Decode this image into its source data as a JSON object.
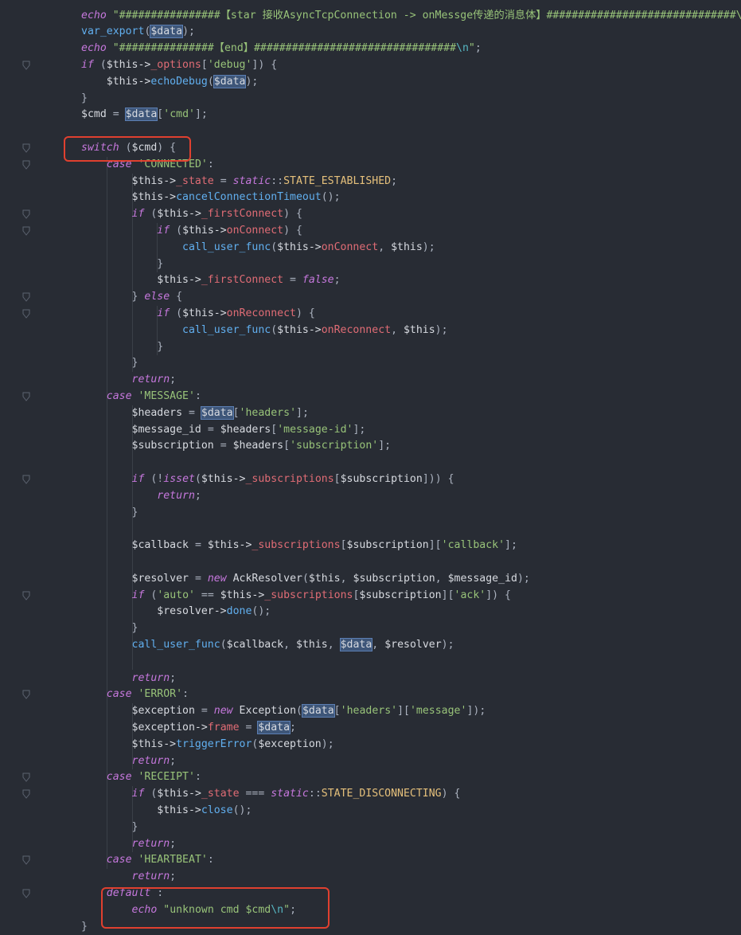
{
  "code_lines": [
    [
      [
        "kw",
        "echo"
      ],
      [
        "punc",
        " "
      ],
      [
        "str",
        "\"################【star 接收AsyncTcpConnection -> onMessge传递的消息体】##############################\\n"
      ]
    ],
    [
      [
        "fn",
        "var_export"
      ],
      [
        "punc",
        "("
      ],
      [
        "hl",
        "$data"
      ],
      [
        "punc",
        ");"
      ]
    ],
    [
      [
        "kw",
        "echo"
      ],
      [
        "punc",
        " "
      ],
      [
        "str",
        "\"###############【end】################################"
      ],
      [
        "esc",
        "\\n"
      ],
      [
        "str",
        "\""
      ],
      [
        "punc",
        ";"
      ]
    ],
    [
      [
        "kw",
        "if"
      ],
      [
        "punc",
        " ("
      ],
      [
        "var",
        "$this->"
      ],
      [
        "prop",
        "_options"
      ],
      [
        "punc",
        "["
      ],
      [
        "str",
        "'debug'"
      ],
      [
        "punc",
        "]) {"
      ]
    ],
    [
      [
        "punc",
        "    "
      ],
      [
        "var",
        "$this->"
      ],
      [
        "fn",
        "echoDebug"
      ],
      [
        "punc",
        "("
      ],
      [
        "hl",
        "$data"
      ],
      [
        "punc",
        ");"
      ]
    ],
    [
      [
        "punc",
        "}"
      ]
    ],
    [
      [
        "var",
        "$cmd"
      ],
      [
        "punc",
        " = "
      ],
      [
        "hl",
        "$data"
      ],
      [
        "punc",
        "["
      ],
      [
        "str",
        "'cmd'"
      ],
      [
        "punc",
        "];"
      ]
    ],
    [],
    [
      [
        "kw",
        "switch"
      ],
      [
        "punc",
        " ("
      ],
      [
        "var",
        "$cmd"
      ],
      [
        "punc",
        ") {"
      ]
    ],
    [
      [
        "punc",
        "    "
      ],
      [
        "kw",
        "case"
      ],
      [
        "punc",
        " "
      ],
      [
        "str",
        "'CONNECTED'"
      ],
      [
        "punc",
        ":"
      ]
    ],
    [
      [
        "punc",
        "        "
      ],
      [
        "var",
        "$this->"
      ],
      [
        "prop",
        "_state"
      ],
      [
        "punc",
        " = "
      ],
      [
        "kw",
        "static"
      ],
      [
        "punc",
        "::"
      ],
      [
        "const",
        "STATE_ESTABLISHED"
      ],
      [
        "punc",
        ";"
      ]
    ],
    [
      [
        "punc",
        "        "
      ],
      [
        "var",
        "$this->"
      ],
      [
        "fn",
        "cancelConnectionTimeout"
      ],
      [
        "punc",
        "();"
      ]
    ],
    [
      [
        "punc",
        "        "
      ],
      [
        "kw",
        "if"
      ],
      [
        "punc",
        " ("
      ],
      [
        "var",
        "$this->"
      ],
      [
        "prop",
        "_firstConnect"
      ],
      [
        "punc",
        ") {"
      ]
    ],
    [
      [
        "punc",
        "            "
      ],
      [
        "kw",
        "if"
      ],
      [
        "punc",
        " ("
      ],
      [
        "var",
        "$this->"
      ],
      [
        "prop",
        "onConnect"
      ],
      [
        "punc",
        ") {"
      ]
    ],
    [
      [
        "punc",
        "                "
      ],
      [
        "fn",
        "call_user_func"
      ],
      [
        "punc",
        "("
      ],
      [
        "var",
        "$this->"
      ],
      [
        "prop",
        "onConnect"
      ],
      [
        "punc",
        ", "
      ],
      [
        "var",
        "$this"
      ],
      [
        "punc",
        ");"
      ]
    ],
    [
      [
        "punc",
        "            }"
      ]
    ],
    [
      [
        "punc",
        "            "
      ],
      [
        "var",
        "$this->"
      ],
      [
        "prop",
        "_firstConnect"
      ],
      [
        "punc",
        " = "
      ],
      [
        "kw",
        "false"
      ],
      [
        "punc",
        ";"
      ]
    ],
    [
      [
        "punc",
        "        } "
      ],
      [
        "kw",
        "else"
      ],
      [
        "punc",
        " {"
      ]
    ],
    [
      [
        "punc",
        "            "
      ],
      [
        "kw",
        "if"
      ],
      [
        "punc",
        " ("
      ],
      [
        "var",
        "$this->"
      ],
      [
        "prop",
        "onReconnect"
      ],
      [
        "punc",
        ") {"
      ]
    ],
    [
      [
        "punc",
        "                "
      ],
      [
        "fn",
        "call_user_func"
      ],
      [
        "punc",
        "("
      ],
      [
        "var",
        "$this->"
      ],
      [
        "prop",
        "onReconnect"
      ],
      [
        "punc",
        ", "
      ],
      [
        "var",
        "$this"
      ],
      [
        "punc",
        ");"
      ]
    ],
    [
      [
        "punc",
        "            }"
      ]
    ],
    [
      [
        "punc",
        "        }"
      ]
    ],
    [
      [
        "punc",
        "        "
      ],
      [
        "kw",
        "return"
      ],
      [
        "punc",
        ";"
      ]
    ],
    [
      [
        "punc",
        "    "
      ],
      [
        "kw",
        "case"
      ],
      [
        "punc",
        " "
      ],
      [
        "str",
        "'MESSAGE'"
      ],
      [
        "punc",
        ":"
      ]
    ],
    [
      [
        "punc",
        "        "
      ],
      [
        "var",
        "$headers"
      ],
      [
        "punc",
        " = "
      ],
      [
        "hl",
        "$data"
      ],
      [
        "punc",
        "["
      ],
      [
        "str",
        "'headers'"
      ],
      [
        "punc",
        "];"
      ]
    ],
    [
      [
        "punc",
        "        "
      ],
      [
        "var",
        "$message_id"
      ],
      [
        "punc",
        " = "
      ],
      [
        "var",
        "$headers"
      ],
      [
        "punc",
        "["
      ],
      [
        "str",
        "'message-id'"
      ],
      [
        "punc",
        "];"
      ]
    ],
    [
      [
        "punc",
        "        "
      ],
      [
        "var",
        "$subscription"
      ],
      [
        "punc",
        " = "
      ],
      [
        "var",
        "$headers"
      ],
      [
        "punc",
        "["
      ],
      [
        "str",
        "'subscription'"
      ],
      [
        "punc",
        "];"
      ]
    ],
    [],
    [
      [
        "punc",
        "        "
      ],
      [
        "kw",
        "if"
      ],
      [
        "punc",
        " (!"
      ],
      [
        "kw",
        "isset"
      ],
      [
        "punc",
        "("
      ],
      [
        "var",
        "$this->"
      ],
      [
        "prop",
        "_subscriptions"
      ],
      [
        "punc",
        "["
      ],
      [
        "var",
        "$subscription"
      ],
      [
        "punc",
        "])) {"
      ]
    ],
    [
      [
        "punc",
        "            "
      ],
      [
        "kw",
        "return"
      ],
      [
        "punc",
        ";"
      ]
    ],
    [
      [
        "punc",
        "        }"
      ]
    ],
    [],
    [
      [
        "punc",
        "        "
      ],
      [
        "var",
        "$callback"
      ],
      [
        "punc",
        " = "
      ],
      [
        "var",
        "$this->"
      ],
      [
        "prop",
        "_subscriptions"
      ],
      [
        "punc",
        "["
      ],
      [
        "var",
        "$subscription"
      ],
      [
        "punc",
        "]["
      ],
      [
        "str",
        "'callback'"
      ],
      [
        "punc",
        "];"
      ]
    ],
    [],
    [
      [
        "punc",
        "        "
      ],
      [
        "var",
        "$resolver"
      ],
      [
        "punc",
        " = "
      ],
      [
        "kw",
        "new"
      ],
      [
        "punc",
        " "
      ],
      [
        "var",
        "AckResolver"
      ],
      [
        "punc",
        "("
      ],
      [
        "var",
        "$this"
      ],
      [
        "punc",
        ", "
      ],
      [
        "var",
        "$subscription"
      ],
      [
        "punc",
        ", "
      ],
      [
        "var",
        "$message_id"
      ],
      [
        "punc",
        ");"
      ]
    ],
    [
      [
        "punc",
        "        "
      ],
      [
        "kw",
        "if"
      ],
      [
        "punc",
        " ("
      ],
      [
        "str",
        "'auto'"
      ],
      [
        "punc",
        " == "
      ],
      [
        "var",
        "$this->"
      ],
      [
        "prop",
        "_subscriptions"
      ],
      [
        "punc",
        "["
      ],
      [
        "var",
        "$subscription"
      ],
      [
        "punc",
        "]["
      ],
      [
        "str",
        "'ack'"
      ],
      [
        "punc",
        "]) {"
      ]
    ],
    [
      [
        "punc",
        "            "
      ],
      [
        "var",
        "$resolver->"
      ],
      [
        "fn",
        "done"
      ],
      [
        "punc",
        "();"
      ]
    ],
    [
      [
        "punc",
        "        }"
      ]
    ],
    [
      [
        "punc",
        "        "
      ],
      [
        "fn",
        "call_user_func"
      ],
      [
        "punc",
        "("
      ],
      [
        "var",
        "$callback"
      ],
      [
        "punc",
        ", "
      ],
      [
        "var",
        "$this"
      ],
      [
        "punc",
        ", "
      ],
      [
        "hl",
        "$data"
      ],
      [
        "punc",
        ", "
      ],
      [
        "var",
        "$resolver"
      ],
      [
        "punc",
        ");"
      ]
    ],
    [],
    [
      [
        "punc",
        "        "
      ],
      [
        "kw",
        "return"
      ],
      [
        "punc",
        ";"
      ]
    ],
    [
      [
        "punc",
        "    "
      ],
      [
        "kw",
        "case"
      ],
      [
        "punc",
        " "
      ],
      [
        "str",
        "'ERROR'"
      ],
      [
        "punc",
        ":"
      ]
    ],
    [
      [
        "punc",
        "        "
      ],
      [
        "var",
        "$exception"
      ],
      [
        "punc",
        " = "
      ],
      [
        "kw",
        "new"
      ],
      [
        "punc",
        " "
      ],
      [
        "var",
        "Exception"
      ],
      [
        "punc",
        "("
      ],
      [
        "hl",
        "$data"
      ],
      [
        "punc",
        "["
      ],
      [
        "str",
        "'headers'"
      ],
      [
        "punc",
        "]["
      ],
      [
        "str",
        "'message'"
      ],
      [
        "punc",
        "]);"
      ]
    ],
    [
      [
        "punc",
        "        "
      ],
      [
        "var",
        "$exception->"
      ],
      [
        "prop",
        "frame"
      ],
      [
        "punc",
        " = "
      ],
      [
        "hl",
        "$data"
      ],
      [
        "punc",
        ";"
      ]
    ],
    [
      [
        "punc",
        "        "
      ],
      [
        "var",
        "$this->"
      ],
      [
        "fn",
        "triggerError"
      ],
      [
        "punc",
        "("
      ],
      [
        "var",
        "$exception"
      ],
      [
        "punc",
        ");"
      ]
    ],
    [
      [
        "punc",
        "        "
      ],
      [
        "kw",
        "return"
      ],
      [
        "punc",
        ";"
      ]
    ],
    [
      [
        "punc",
        "    "
      ],
      [
        "kw",
        "case"
      ],
      [
        "punc",
        " "
      ],
      [
        "str",
        "'RECEIPT'"
      ],
      [
        "punc",
        ":"
      ]
    ],
    [
      [
        "punc",
        "        "
      ],
      [
        "kw",
        "if"
      ],
      [
        "punc",
        " ("
      ],
      [
        "var",
        "$this->"
      ],
      [
        "prop",
        "_state"
      ],
      [
        "punc",
        " === "
      ],
      [
        "kw",
        "static"
      ],
      [
        "punc",
        "::"
      ],
      [
        "const",
        "STATE_DISCONNECTING"
      ],
      [
        "punc",
        ") {"
      ]
    ],
    [
      [
        "punc",
        "            "
      ],
      [
        "var",
        "$this->"
      ],
      [
        "fn",
        "close"
      ],
      [
        "punc",
        "();"
      ]
    ],
    [
      [
        "punc",
        "        }"
      ]
    ],
    [
      [
        "punc",
        "        "
      ],
      [
        "kw",
        "return"
      ],
      [
        "punc",
        ";"
      ]
    ],
    [
      [
        "punc",
        "    "
      ],
      [
        "kw",
        "case"
      ],
      [
        "punc",
        " "
      ],
      [
        "str",
        "'HEARTBEAT'"
      ],
      [
        "punc",
        ":"
      ]
    ],
    [
      [
        "punc",
        "        "
      ],
      [
        "kw",
        "return"
      ],
      [
        "punc",
        ";"
      ]
    ],
    [
      [
        "punc",
        "    "
      ],
      [
        "kw",
        "default"
      ],
      [
        "punc",
        " :"
      ]
    ],
    [
      [
        "punc",
        "        "
      ],
      [
        "kw",
        "echo"
      ],
      [
        "punc",
        " "
      ],
      [
        "str",
        "\"unknown cmd $cmd"
      ],
      [
        "esc",
        "\\n"
      ],
      [
        "str",
        "\""
      ],
      [
        "punc",
        ";"
      ]
    ],
    [
      [
        "punc",
        "}"
      ]
    ]
  ],
  "fold_rows": [
    3,
    8,
    9,
    12,
    13,
    17,
    18,
    23,
    28,
    35,
    41,
    46,
    47,
    51,
    53
  ],
  "colors": {
    "background": "#282c34",
    "keyword": "#c678dd",
    "function": "#61afef",
    "property": "#e06c75",
    "string": "#98c379",
    "constant": "#e5c07b",
    "highlight_box": "#e0402f"
  }
}
